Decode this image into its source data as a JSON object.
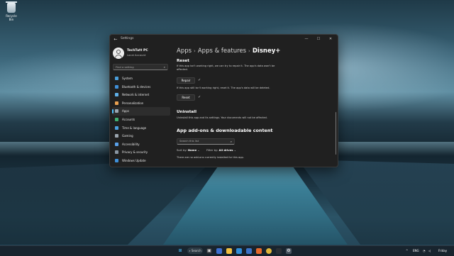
{
  "desktop": {
    "recycle_bin_label": "Recycle Bin"
  },
  "window": {
    "title": "Settings",
    "controls": {
      "minimize": "—",
      "maximize": "☐",
      "close": "✕"
    },
    "back_glyph": "←"
  },
  "user": {
    "name": "TechTutt PC",
    "account": "Local Account"
  },
  "sidebar": {
    "search_placeholder": "Find a setting",
    "search_icon": "search-icon",
    "items": [
      {
        "label": "System",
        "icon": "monitor-icon",
        "color": "#4a9eda"
      },
      {
        "label": "Bluetooth & devices",
        "icon": "bluetooth-icon",
        "color": "#3f8fd8"
      },
      {
        "label": "Network & internet",
        "icon": "wifi-icon",
        "color": "#5fb0e8"
      },
      {
        "label": "Personalization",
        "icon": "brush-icon",
        "color": "#e8a050"
      },
      {
        "label": "Apps",
        "icon": "apps-icon",
        "color": "#9aa7b3",
        "selected": true
      },
      {
        "label": "Accounts",
        "icon": "person-icon",
        "color": "#3fb070"
      },
      {
        "label": "Time & language",
        "icon": "clock-icon",
        "color": "#4aa0e0"
      },
      {
        "label": "Gaming",
        "icon": "controller-icon",
        "color": "#9ba5ae"
      },
      {
        "label": "Accessibility",
        "icon": "accessibility-icon",
        "color": "#5aa0e8"
      },
      {
        "label": "Privacy & security",
        "icon": "shield-icon",
        "color": "#8a96a2"
      },
      {
        "label": "Windows Update",
        "icon": "update-icon",
        "color": "#3f8fd8"
      }
    ]
  },
  "breadcrumb": {
    "part1": "Apps",
    "part2": "Apps & features",
    "current": "Disney+"
  },
  "reset": {
    "heading": "Reset",
    "repair_text": "If this app isn't working right, we can try to repair it. The app's data won't be affected.",
    "repair_button": "Repair",
    "reset_text": "If this app still isn't working right, reset it. The app's data will be deleted.",
    "reset_button": "Reset",
    "check": "✓"
  },
  "uninstall": {
    "heading": "Uninstall",
    "text": "Uninstall this app and its settings. Your documents will not be affected."
  },
  "addons": {
    "heading": "App add-ons & downloadable content",
    "search_placeholder": "Search this list",
    "sort_label": "Sort by:",
    "sort_value": "Name",
    "filter_label": "Filter by:",
    "filter_value": "All drives",
    "empty_text": "There are no add-ons currently installed for this app."
  },
  "taskbar": {
    "search_label": "Search",
    "tray": {
      "lang": "ENG",
      "day": "Friday"
    }
  }
}
